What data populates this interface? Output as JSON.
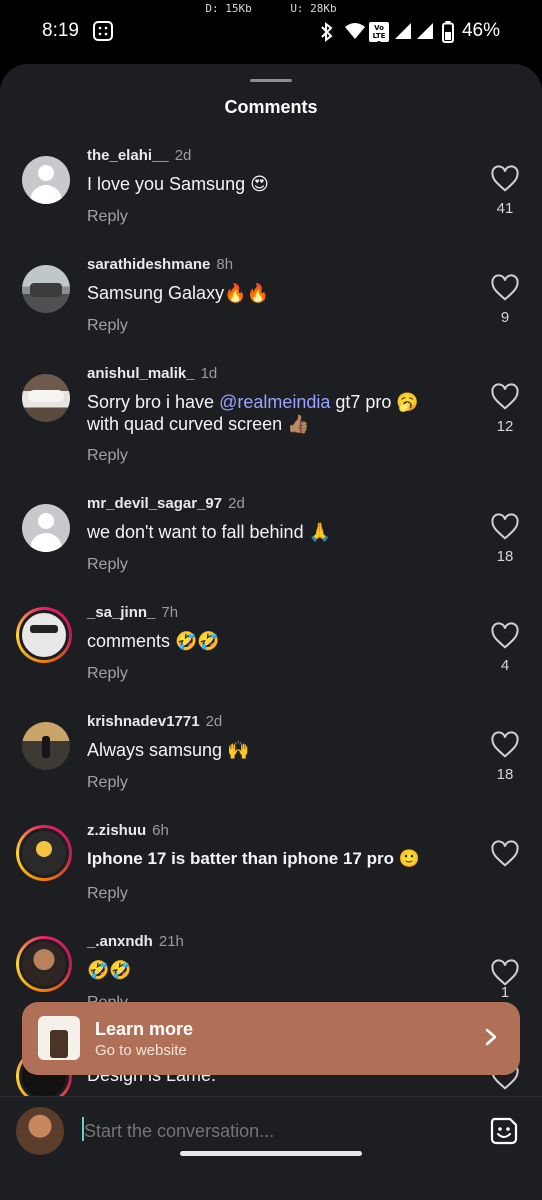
{
  "status_bar": {
    "time": "8:19",
    "download_speed": "D: 15Kb",
    "upload_speed": "U: 28Kb",
    "battery": "46%",
    "network_label": "Vo LTE 2"
  },
  "sheet": {
    "title": "Comments"
  },
  "comments": [
    {
      "username": "the_elahi__",
      "time": "2d",
      "text": "I love you Samsung 😍",
      "reply": "Reply",
      "likes": "41",
      "avatar": "default"
    },
    {
      "username": "sarathideshmane",
      "time": "8h",
      "text": "Samsung Galaxy🔥🔥",
      "reply": "Reply",
      "likes": "9",
      "avatar": "car-photo"
    },
    {
      "username": "anishul_malik_",
      "time": "1d",
      "text_before": "Sorry bro i have ",
      "mention": "@realmeindia",
      "text_after": " gt7 pro 🥱 with quad curved screen 👍🏽",
      "reply": "Reply",
      "likes": "12",
      "avatar": "car-photo"
    },
    {
      "username": "mr_devil_sagar_97",
      "time": "2d",
      "text": "we don't want to fall behind 🙏",
      "reply": "Reply",
      "likes": "18",
      "avatar": "default"
    },
    {
      "username": "_sa_jinn_",
      "time": "7h",
      "text": "comments 🤣🤣",
      "reply": "Reply",
      "likes": "4",
      "avatar": "story-ring"
    },
    {
      "username": "krishnadev1771",
      "time": "2d",
      "text": "Always samsung 🙌",
      "reply": "Reply",
      "likes": "18",
      "avatar": "photo"
    },
    {
      "username": "z.zishuu",
      "time": "6h",
      "text": "Iphone 17 is batter than iphone 17 pro 🙂",
      "reply": "Reply",
      "likes": "",
      "avatar": "story-ring"
    },
    {
      "username": "_.anxndh",
      "time": "21h",
      "text": "🤣🤣",
      "reply": "Reply",
      "likes": "1",
      "avatar": "story-ring"
    },
    {
      "username": "",
      "time": "",
      "text": "Design is Lame.",
      "reply": "",
      "likes": "",
      "avatar": "story-ring"
    }
  ],
  "ad": {
    "title": "Learn more",
    "subtitle": "Go to website"
  },
  "input": {
    "placeholder": "Start the conversation..."
  },
  "colors": {
    "sheet_bg": "#1c1e22",
    "ad_bg": "#b07058",
    "mention": "#9aa3ff"
  }
}
